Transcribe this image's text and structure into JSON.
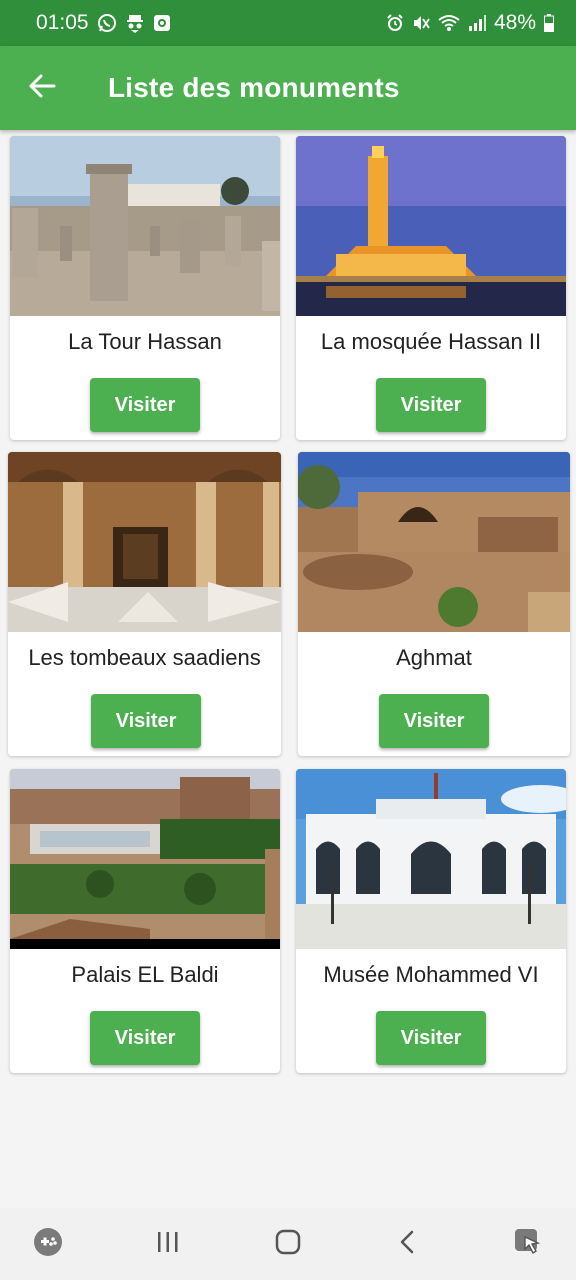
{
  "status_bar": {
    "time": "01:05",
    "battery": "48%",
    "left_icons": [
      "whatsapp-icon",
      "incognito-icon",
      "recorder-icon"
    ],
    "right_icons": [
      "alarm-icon",
      "mute-icon",
      "wifi-icon",
      "signal-icon",
      "battery-icon"
    ]
  },
  "app_bar": {
    "title": "Liste des monuments",
    "back_icon": "arrow-left-icon",
    "color": "#4caf50"
  },
  "monuments": [
    {
      "name": "La Tour Hassan",
      "button_label": "Visiter"
    },
    {
      "name": "La mosquée Hassan II",
      "button_label": "Visiter"
    },
    {
      "name": "Les tombeaux saadiens",
      "button_label": "Visiter"
    },
    {
      "name": "Aghmat",
      "button_label": "Visiter"
    },
    {
      "name": "Palais EL Baldi",
      "button_label": "Visiter"
    },
    {
      "name": "Musée Mohammed VI",
      "button_label": "Visiter"
    }
  ],
  "nav_bar": {
    "icons": [
      "game-launcher-icon",
      "recent-apps-icon",
      "home-icon",
      "back-icon",
      "assistant-icon"
    ]
  }
}
